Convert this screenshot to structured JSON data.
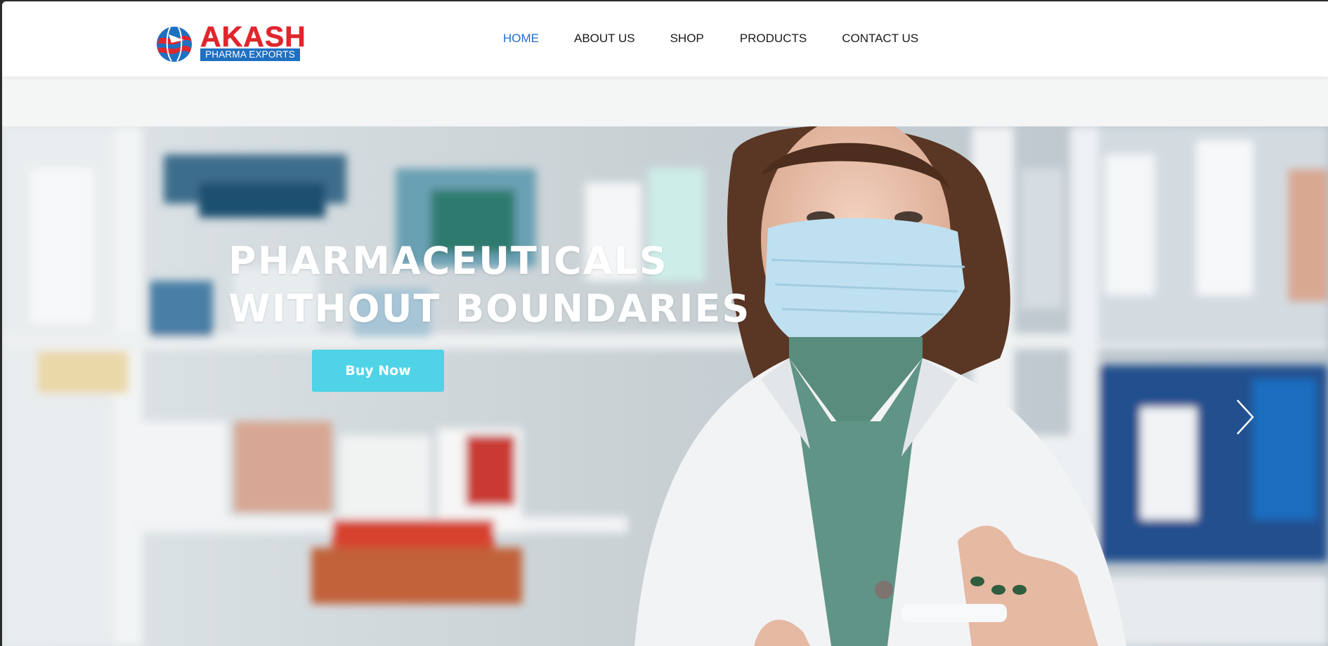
{
  "brand": {
    "name": "AKASH",
    "tagline": "PHARMA EXPORTS",
    "colors": {
      "red": "#e0262c",
      "blue": "#1f70c1"
    },
    "icon": "globe-logo-icon"
  },
  "nav": {
    "items": [
      {
        "label": "HOME",
        "active": true
      },
      {
        "label": "ABOUT US",
        "active": false
      },
      {
        "label": "SHOP",
        "active": false
      },
      {
        "label": "PRODUCTS",
        "active": false
      },
      {
        "label": "CONTACT US",
        "active": false
      }
    ],
    "active_color": "#1e6fc8"
  },
  "hero": {
    "title_line1": "PHARMACEUTICALS",
    "title_line2": "WITHOUT BOUNDARIES",
    "button_label": "Buy Now",
    "button_color": "#4fd3e6",
    "prev_icon": "chevron-left-icon",
    "next_icon": "chevron-right-icon",
    "image": "pharmacist-in-mask-photo"
  }
}
